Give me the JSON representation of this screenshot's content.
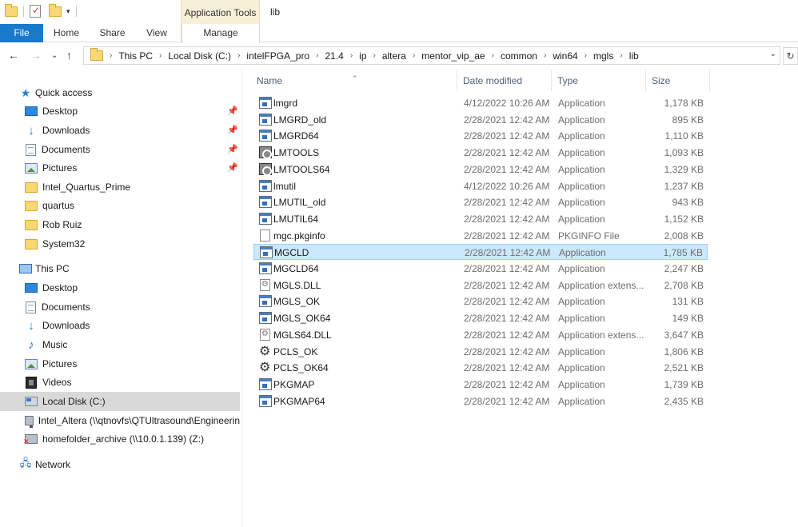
{
  "window": {
    "title": "lib"
  },
  "ribbon": {
    "context_title": "Application Tools",
    "tabs": [
      {
        "label": "File"
      },
      {
        "label": "Home"
      },
      {
        "label": "Share"
      },
      {
        "label": "View"
      },
      {
        "label": "Manage"
      }
    ]
  },
  "address": {
    "crumbs": [
      "This PC",
      "Local Disk (C:)",
      "intelFPGA_pro",
      "21.4",
      "ip",
      "altera",
      "mentor_vip_ae",
      "common",
      "win64",
      "mgls",
      "lib"
    ]
  },
  "nav": {
    "quick_access": "Quick access",
    "quick_items": [
      {
        "label": "Desktop",
        "icon": "desktop-icon",
        "pinned": true
      },
      {
        "label": "Downloads",
        "icon": "download-icon",
        "pinned": true
      },
      {
        "label": "Documents",
        "icon": "documents-icon",
        "pinned": true
      },
      {
        "label": "Pictures",
        "icon": "pictures-icon",
        "pinned": true
      },
      {
        "label": "Intel_Quartus_Prime",
        "icon": "folder-icon",
        "pinned": false
      },
      {
        "label": "quartus",
        "icon": "folder-icon",
        "pinned": false
      },
      {
        "label": "Rob Ruiz",
        "icon": "folder-icon",
        "pinned": false
      },
      {
        "label": "System32",
        "icon": "folder-icon",
        "pinned": false
      }
    ],
    "this_pc": "This PC",
    "pc_items": [
      {
        "label": "Desktop",
        "icon": "desktop-icon"
      },
      {
        "label": "Documents",
        "icon": "documents-icon"
      },
      {
        "label": "Downloads",
        "icon": "download-icon"
      },
      {
        "label": "Music",
        "icon": "music-icon"
      },
      {
        "label": "Pictures",
        "icon": "pictures-icon"
      },
      {
        "label": "Videos",
        "icon": "videos-icon"
      },
      {
        "label": "Local Disk (C:)",
        "icon": "disk-icon",
        "selected": true
      },
      {
        "label": "Intel_Altera (\\\\qtnovfs\\QTUltrasound\\Engineerin",
        "icon": "network-drive-icon"
      },
      {
        "label": "homefolder_archive (\\\\10.0.1.139) (Z:)",
        "icon": "disconnected-drive-icon"
      }
    ],
    "network": "Network"
  },
  "columns": {
    "name": "Name",
    "date": "Date modified",
    "type": "Type",
    "size": "Size"
  },
  "files": [
    {
      "name": "lmgrd",
      "date": "4/12/2022 10:26 AM",
      "type": "Application",
      "size": "1,178 KB",
      "icon": "app"
    },
    {
      "name": "LMGRD_old",
      "date": "2/28/2021 12:42 AM",
      "type": "Application",
      "size": "895 KB",
      "icon": "app"
    },
    {
      "name": "LMGRD64",
      "date": "2/28/2021 12:42 AM",
      "type": "Application",
      "size": "1,110 KB",
      "icon": "app"
    },
    {
      "name": "LMTOOLS",
      "date": "2/28/2021 12:42 AM",
      "type": "Application",
      "size": "1,093 KB",
      "icon": "tool"
    },
    {
      "name": "LMTOOLS64",
      "date": "2/28/2021 12:42 AM",
      "type": "Application",
      "size": "1,329 KB",
      "icon": "tool"
    },
    {
      "name": "lmutil",
      "date": "4/12/2022 10:26 AM",
      "type": "Application",
      "size": "1,237 KB",
      "icon": "app"
    },
    {
      "name": "LMUTIL_old",
      "date": "2/28/2021 12:42 AM",
      "type": "Application",
      "size": "943 KB",
      "icon": "app"
    },
    {
      "name": "LMUTIL64",
      "date": "2/28/2021 12:42 AM",
      "type": "Application",
      "size": "1,152 KB",
      "icon": "app"
    },
    {
      "name": "mgc.pkginfo",
      "date": "2/28/2021 12:42 AM",
      "type": "PKGINFO File",
      "size": "2,008 KB",
      "icon": "file"
    },
    {
      "name": "MGCLD",
      "date": "2/28/2021 12:42 AM",
      "type": "Application",
      "size": "1,785 KB",
      "icon": "app",
      "selected": true
    },
    {
      "name": "MGCLD64",
      "date": "2/28/2021 12:42 AM",
      "type": "Application",
      "size": "2,247 KB",
      "icon": "app"
    },
    {
      "name": "MGLS.DLL",
      "date": "2/28/2021 12:42 AM",
      "type": "Application extens...",
      "size": "2,708 KB",
      "icon": "dll"
    },
    {
      "name": "MGLS_OK",
      "date": "2/28/2021 12:42 AM",
      "type": "Application",
      "size": "131 KB",
      "icon": "app"
    },
    {
      "name": "MGLS_OK64",
      "date": "2/28/2021 12:42 AM",
      "type": "Application",
      "size": "149 KB",
      "icon": "app"
    },
    {
      "name": "MGLS64.DLL",
      "date": "2/28/2021 12:42 AM",
      "type": "Application extens...",
      "size": "3,647 KB",
      "icon": "dll"
    },
    {
      "name": "PCLS_OK",
      "date": "2/28/2021 12:42 AM",
      "type": "Application",
      "size": "1,806 KB",
      "icon": "gear"
    },
    {
      "name": "PCLS_OK64",
      "date": "2/28/2021 12:42 AM",
      "type": "Application",
      "size": "2,521 KB",
      "icon": "gear"
    },
    {
      "name": "PKGMAP",
      "date": "2/28/2021 12:42 AM",
      "type": "Application",
      "size": "1,739 KB",
      "icon": "app"
    },
    {
      "name": "PKGMAP64",
      "date": "2/28/2021 12:42 AM",
      "type": "Application",
      "size": "2,435 KB",
      "icon": "app"
    }
  ],
  "colors": {
    "accent": "#1979ca",
    "selection_bg": "#cce8ff",
    "selection_border": "#99d1ff",
    "context_tab": "#f7f0d8"
  }
}
